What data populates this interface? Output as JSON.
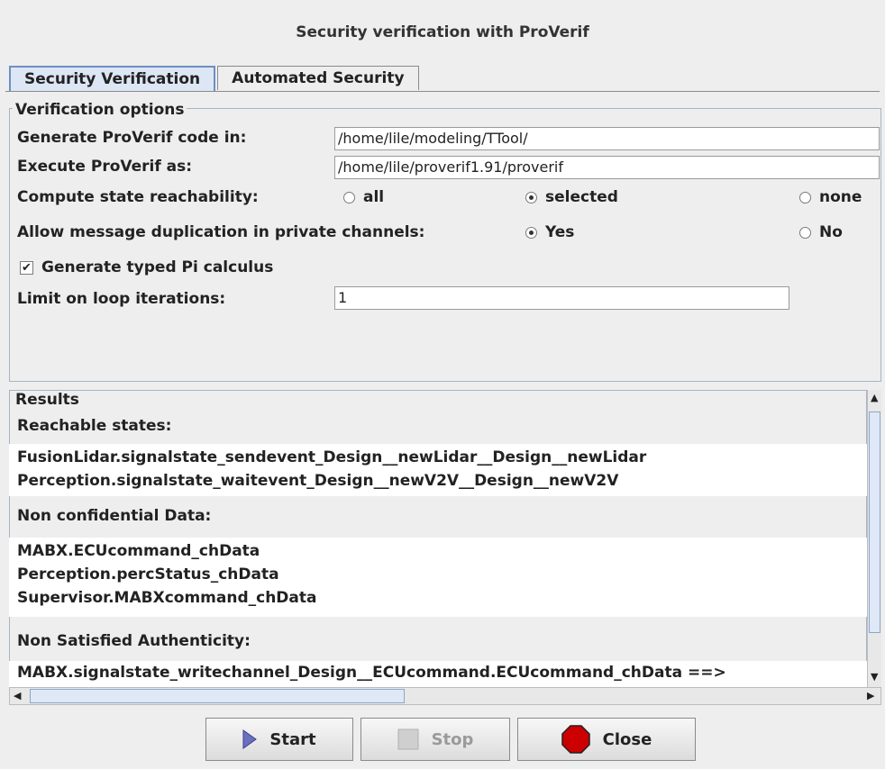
{
  "window": {
    "title": "Security verification with ProVerif"
  },
  "tabs": [
    {
      "label": "Security Verification",
      "active": true
    },
    {
      "label": "Automated Security",
      "active": false
    }
  ],
  "options": {
    "legend": "Verification options",
    "generate_code_label": "Generate ProVerif code in:",
    "generate_code_value": "/home/lile/modeling/TTool/",
    "execute_label": "Execute ProVerif as:",
    "execute_value": "/home/lile/proverif1.91/proverif",
    "reachability_label": "Compute state reachability:",
    "reachability_options": [
      {
        "label": "all",
        "selected": false
      },
      {
        "label": "selected",
        "selected": true
      },
      {
        "label": "none",
        "selected": false
      }
    ],
    "duplication_label": "Allow message duplication in private channels:",
    "duplication_options": [
      {
        "label": "Yes",
        "selected": true
      },
      {
        "label": "No",
        "selected": false
      }
    ],
    "typed_pi_label": "Generate typed Pi calculus",
    "typed_pi_checked": true,
    "loop_label": "Limit on loop iterations:",
    "loop_value": "1"
  },
  "results": {
    "legend": "Results",
    "reachable_header": "Reachable states:",
    "reachable": [
      "FusionLidar.signalstate_sendevent_Design__newLidar__Design__newLidar",
      "Perception.signalstate_waitevent_Design__newV2V__Design__newV2V"
    ],
    "nonconf_header": "Non confidential Data:",
    "nonconf": [
      "MABX.ECUcommand_chData",
      "Perception.percStatus_chData",
      "Supervisor.MABXcommand_chData"
    ],
    "nonauth_header": "Non Satisfied Authenticity:",
    "nonauth": [
      "MABX.signalstate_writechannel_Design__ECUcommand.ECUcommand_chData ==>"
    ]
  },
  "buttons": {
    "start_label": "Start",
    "stop_label": "Stop",
    "close_label": "Close"
  },
  "colors": {
    "tab_active": "#dde6f4",
    "play_icon": "#6a6fc0",
    "close_icon": "#cc0000"
  }
}
